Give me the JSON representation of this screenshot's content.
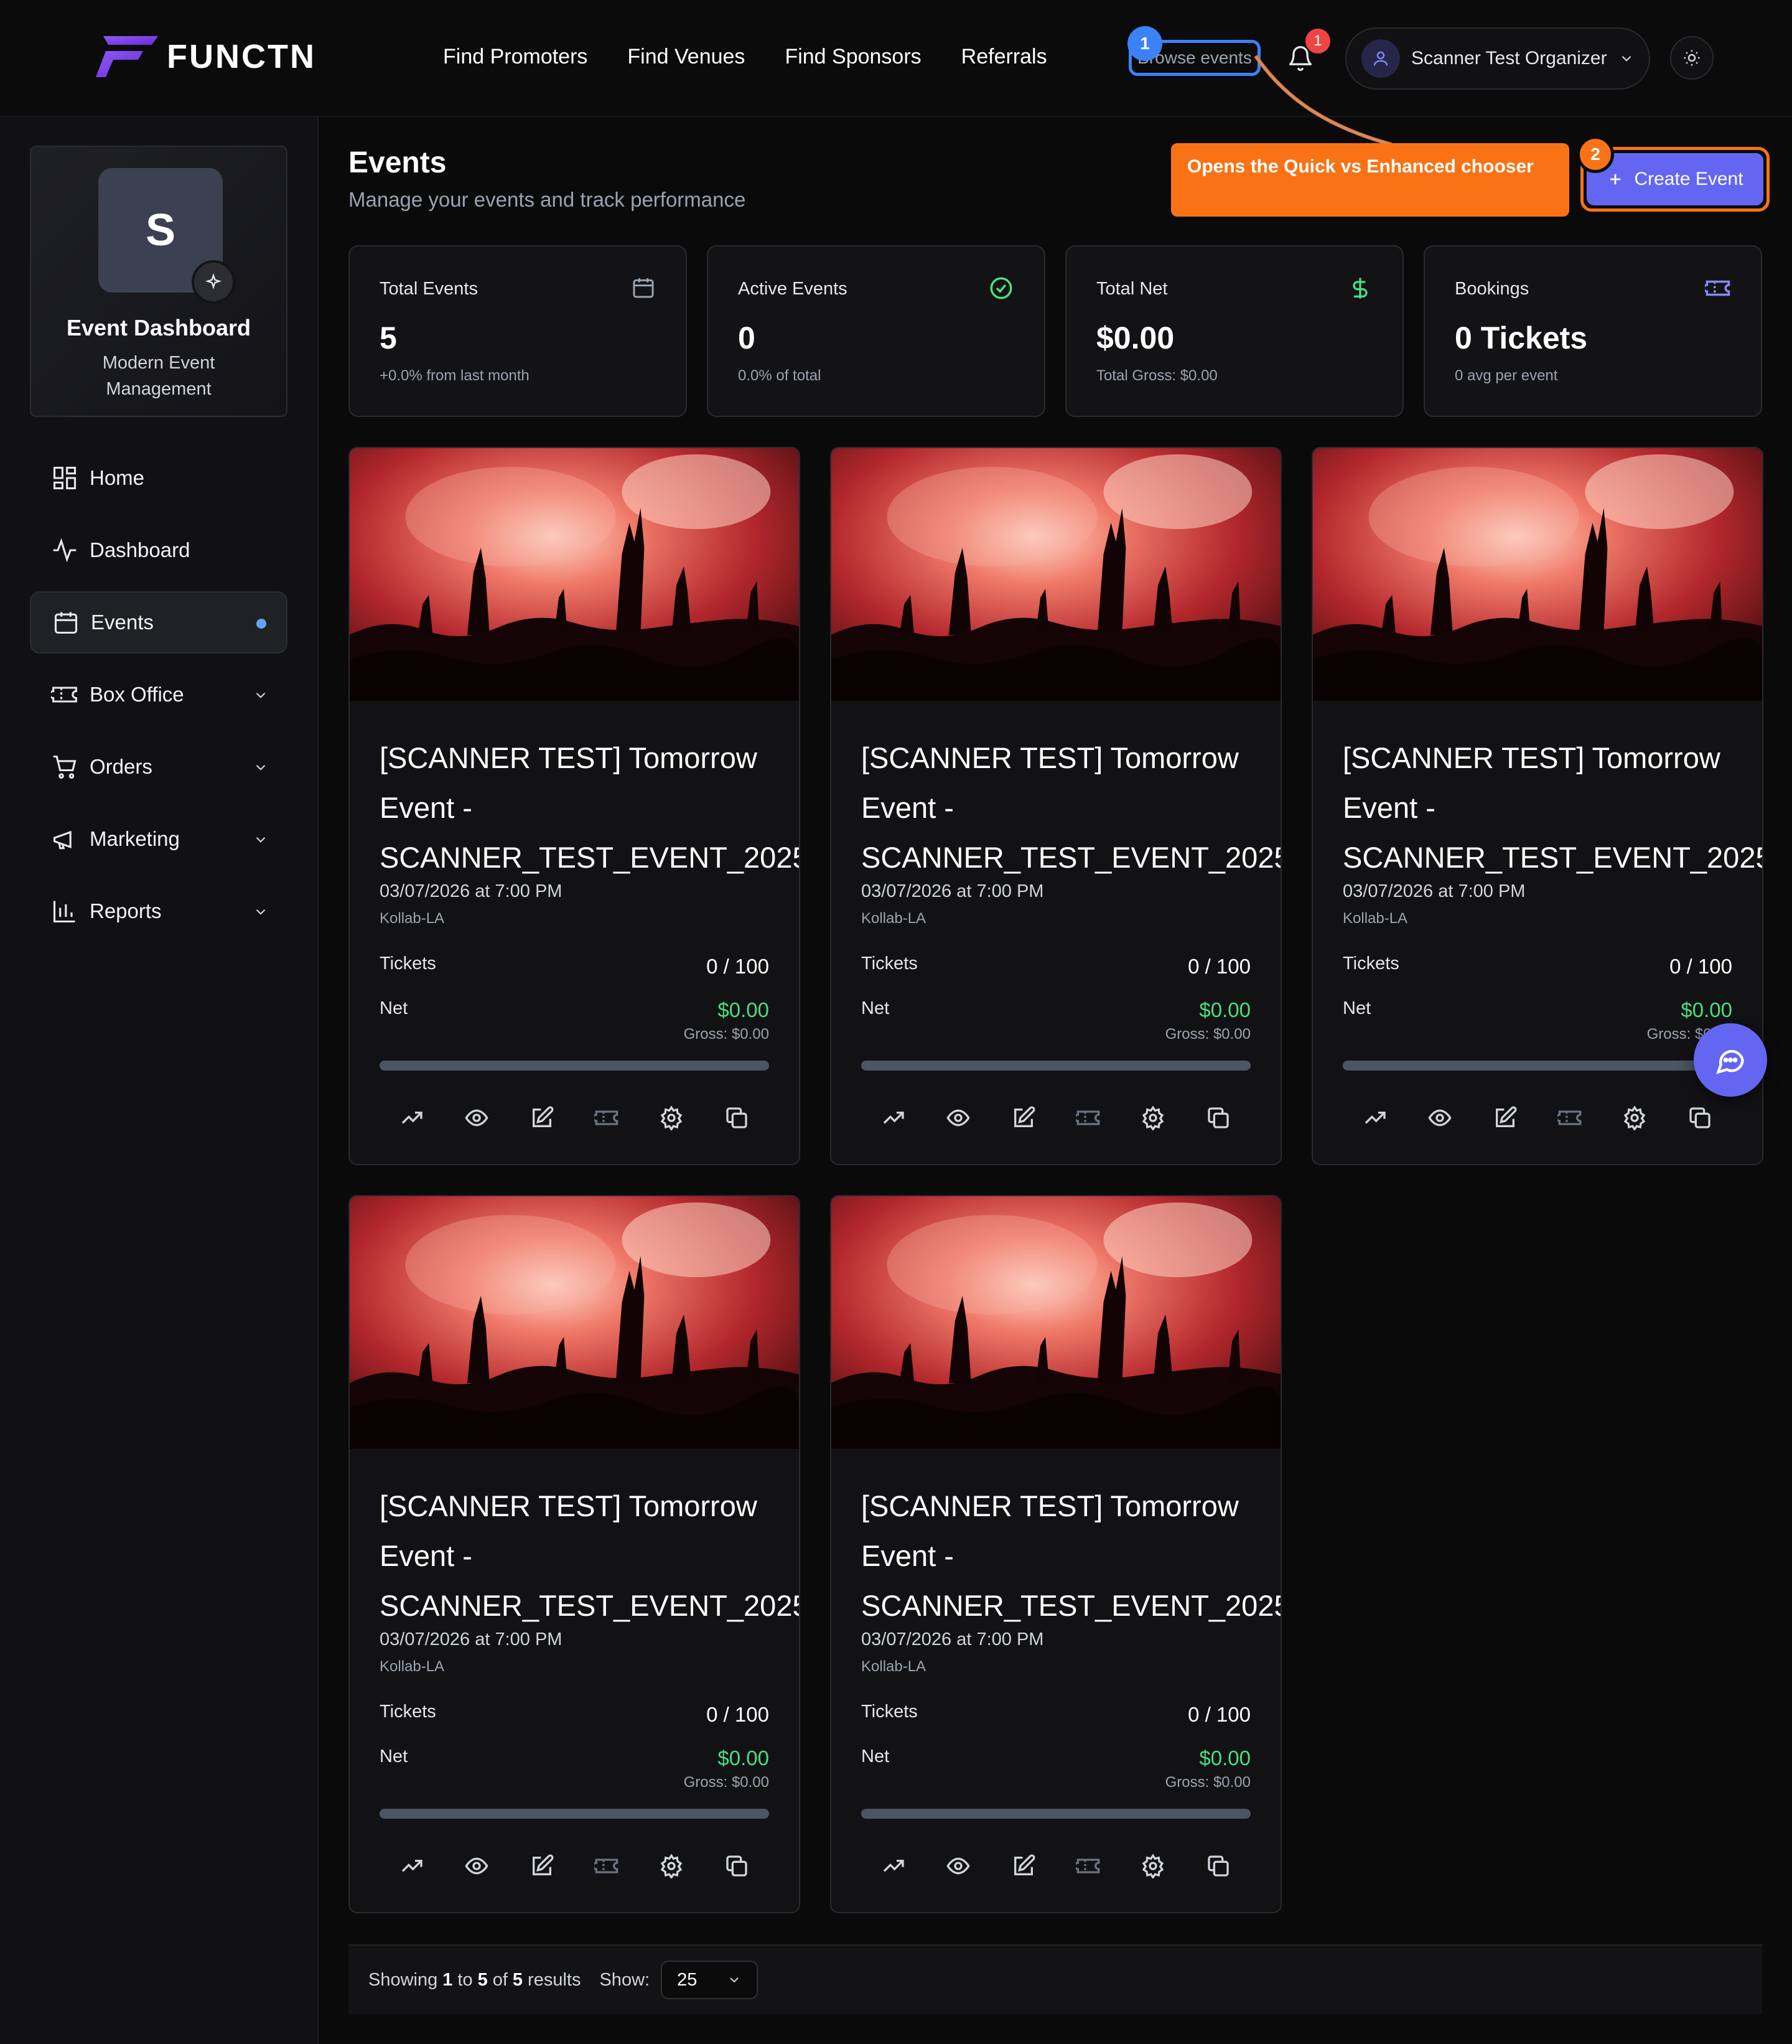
{
  "brand": {
    "name": "FUNCTN",
    "accent": "#7c5cff"
  },
  "nav": {
    "links": [
      "Find Promoters",
      "Find Venues",
      "Find Sponsors",
      "Referrals"
    ],
    "browse_label": "Browse events",
    "browse_step": "1",
    "notification_count": "1",
    "user_name": "Scanner Test Organizer"
  },
  "sidebar": {
    "profile": {
      "initial": "S",
      "title": "Event Dashboard",
      "subtitle": "Modern Event Management"
    },
    "items": [
      {
        "label": "Home",
        "icon": "grid-icon"
      },
      {
        "label": "Dashboard",
        "icon": "activity-icon"
      },
      {
        "label": "Events",
        "icon": "calendar-icon",
        "active": true
      },
      {
        "label": "Box Office",
        "icon": "ticket-icon"
      },
      {
        "label": "Orders",
        "icon": "cart-icon"
      },
      {
        "label": "Marketing",
        "icon": "megaphone-icon"
      },
      {
        "label": "Reports",
        "icon": "bar-chart-icon"
      }
    ]
  },
  "header": {
    "title": "Events",
    "subtitle": "Manage your events and track performance",
    "create_label": "Create Event",
    "create_step": "2",
    "tooltip": "Opens the Quick vs Enhanced chooser"
  },
  "stats": [
    {
      "label": "Total Events",
      "value": "5",
      "note": "+0.0% from last month",
      "icon": "calendar-icon",
      "icon_color": "#9ca3af"
    },
    {
      "label": "Active Events",
      "value": "0",
      "note": "0.0% of total",
      "icon": "check-circle-icon",
      "icon_color": "#4ade80"
    },
    {
      "label": "Total Net",
      "value": "$0.00",
      "note": "Total Gross: $0.00",
      "icon": "dollar-icon",
      "icon_color": "#4ade80"
    },
    {
      "label": "Bookings",
      "value": "0 Tickets",
      "note": "0 avg per event",
      "icon": "ticket-icon",
      "icon_color": "#818cf8"
    }
  ],
  "events": [
    {
      "title_line1": "[SCANNER TEST] Tomorrow",
      "title_line2": "Event -",
      "title_line3": "SCANNER_TEST_EVENT_2025",
      "date": "03/07/2026 at 7:00 PM",
      "venue": "Kollab-LA",
      "tickets_label": "Tickets",
      "tickets": "0 / 100",
      "sold_fraction": 0,
      "net_label": "Net",
      "net": "$0.00",
      "gross": "Gross: $0.00"
    },
    {
      "title_line1": "[SCANNER TEST] Tomorrow",
      "title_line2": "Event -",
      "title_line3": "SCANNER_TEST_EVENT_2025",
      "date": "03/07/2026 at 7:00 PM",
      "venue": "Kollab-LA",
      "tickets_label": "Tickets",
      "tickets": "0 / 100",
      "sold_fraction": 0,
      "net_label": "Net",
      "net": "$0.00",
      "gross": "Gross: $0.00"
    },
    {
      "title_line1": "[SCANNER TEST] Tomorrow",
      "title_line2": "Event -",
      "title_line3": "SCANNER_TEST_EVENT_2025",
      "date": "03/07/2026 at 7:00 PM",
      "venue": "Kollab-LA",
      "tickets_label": "Tickets",
      "tickets": "0 / 100",
      "sold_fraction": 0,
      "net_label": "Net",
      "net": "$0.00",
      "gross": "Gross: $0.00"
    },
    {
      "title_line1": "[SCANNER TEST] Tomorrow",
      "title_line2": "Event -",
      "title_line3": "SCANNER_TEST_EVENT_2025",
      "date": "03/07/2026 at 7:00 PM",
      "venue": "Kollab-LA",
      "tickets_label": "Tickets",
      "tickets": "0 / 100",
      "sold_fraction": 0,
      "net_label": "Net",
      "net": "$0.00",
      "gross": "Gross: $0.00"
    },
    {
      "title_line1": "[SCANNER TEST] Tomorrow",
      "title_line2": "Event -",
      "title_line3": "SCANNER_TEST_EVENT_2025",
      "date": "03/07/2026 at 7:00 PM",
      "venue": "Kollab-LA",
      "tickets_label": "Tickets",
      "tickets": "0 / 100",
      "sold_fraction": 0,
      "net_label": "Net",
      "net": "$0.00",
      "gross": "Gross: $0.00"
    }
  ],
  "event_actions": [
    "trending-up-icon",
    "eye-icon",
    "edit-icon",
    "ticket-icon",
    "settings-icon",
    "copy-icon"
  ],
  "pager": {
    "showing": "Showing",
    "from": "1",
    "to_word": "to",
    "to": "5",
    "of_word": "of",
    "total": "5",
    "results": "results",
    "show_label": "Show:",
    "page_size": "25"
  }
}
